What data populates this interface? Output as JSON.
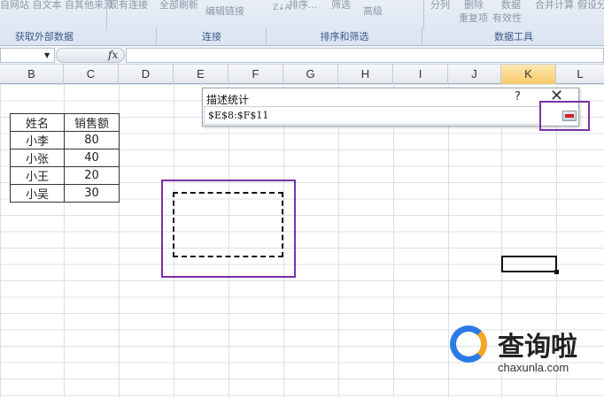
{
  "ribbon": {
    "items": [
      "自网站 自文本 自其他来源",
      "现有连接",
      "全部刷新",
      "编辑链接",
      "排序...",
      "筛选",
      "高级",
      "分列",
      "删除",
      "数据",
      "合并计算",
      "假设分",
      "重复项",
      "有效性"
    ],
    "groups": [
      "获取外部数据",
      "连接",
      "排序和筛选",
      "数据工具"
    ]
  },
  "formula_bar": {
    "fx_label": "fx",
    "value": ""
  },
  "columns": [
    "B",
    "C",
    "D",
    "E",
    "F",
    "G",
    "H",
    "I",
    "J",
    "K",
    "L"
  ],
  "table": {
    "header": [
      "姓名",
      "销售额"
    ],
    "rows": [
      [
        "小李",
        "80"
      ],
      [
        "小张",
        "40"
      ],
      [
        "小王",
        "20"
      ],
      [
        "小吴",
        "30"
      ]
    ]
  },
  "dialog": {
    "title": "描述统计",
    "help": "?",
    "close": "✕",
    "range_value": "$E$8:$F$11"
  },
  "watermark": {
    "text": "查询啦",
    "url": "chaxunla.com"
  },
  "colors": {
    "annotation": "#7a2fa7",
    "selected_column": "#f7c96a",
    "accent_blue": "#2c7be5",
    "accent_orange": "#f5a623"
  }
}
